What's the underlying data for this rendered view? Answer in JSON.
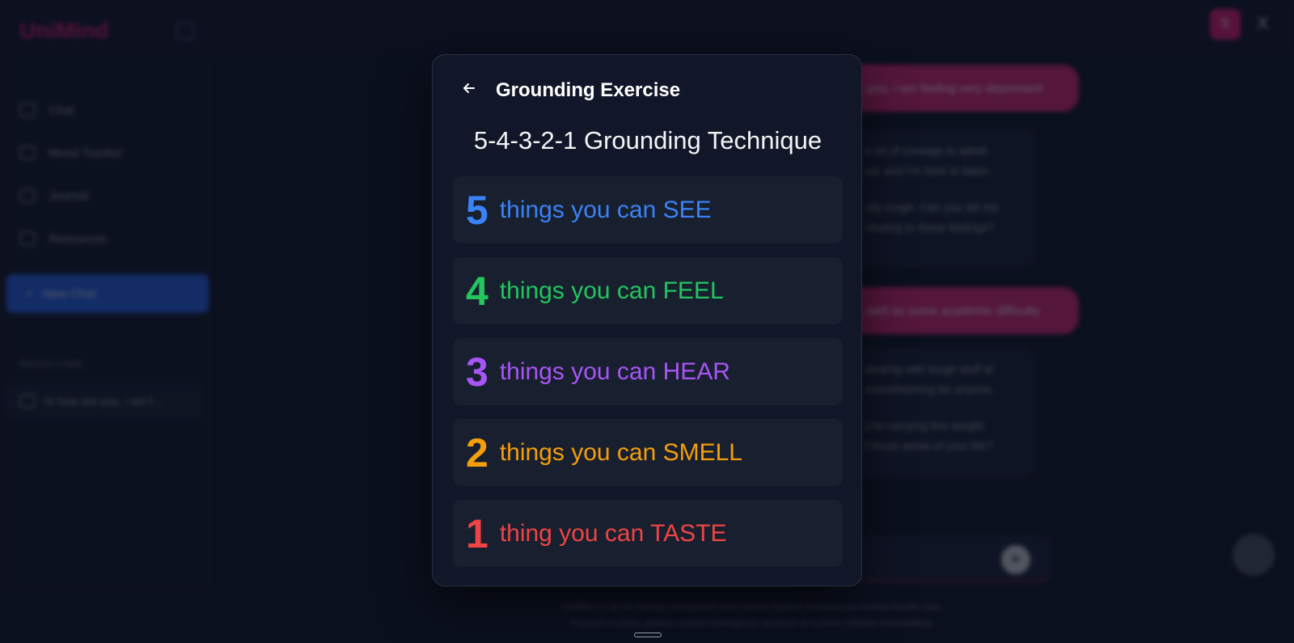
{
  "app": {
    "brand": "UniMind",
    "avatar_initial": "S",
    "close_symbol": "X"
  },
  "sidebar": {
    "items": [
      {
        "label": "Chat",
        "icon": "chat-icon"
      },
      {
        "label": "Mood Tracker",
        "icon": "mood-icon"
      },
      {
        "label": "Journal",
        "icon": "journal-icon"
      },
      {
        "label": "Resources",
        "icon": "resources-icon"
      }
    ],
    "new_chat_label": "New Chat",
    "recent_label": "Recent Chats",
    "recent_items": [
      "hi how are you, i am f..."
    ]
  },
  "chat": {
    "messages": [
      {
        "role": "user",
        "text": "...you, i am feeling very depressed"
      },
      {
        "role": "assistant",
        "lines": [
          "...a lot of courage to admit",
          "...ed, and I'm here to listen",
          "",
          "...ally tough. Can you tell me",
          "...ributing to these feelings?"
        ]
      },
      {
        "role": "user",
        "text": "...well as some academic difficulty"
      },
      {
        "role": "assistant",
        "lines": [
          "...dealing with tough stuff at",
          "...overwhelming for anyone.",
          "",
          "...u're carrying this weight",
          "...f those areas of your life?"
        ]
      }
    ],
    "disclaimer": [
      "UniMind is an AI therapy companion and cannot replace professional mental health care.",
      "If you're in crisis, please contact emergency services or a crisis helpline immediately."
    ]
  },
  "modal": {
    "back_label": "←",
    "title": "Grounding Exercise",
    "technique_title": "5-4-3-2-1 Grounding Technique",
    "steps": [
      {
        "number": "5",
        "text": "things you can SEE",
        "color": "#3b82f6"
      },
      {
        "number": "4",
        "text": "things you can FEEL",
        "color": "#22c55e"
      },
      {
        "number": "3",
        "text": "things you can HEAR",
        "color": "#a855f7"
      },
      {
        "number": "2",
        "text": "things you can SMELL",
        "color": "#f59e0b"
      },
      {
        "number": "1",
        "text": "thing you can TASTE",
        "color": "#ef4444"
      }
    ]
  }
}
